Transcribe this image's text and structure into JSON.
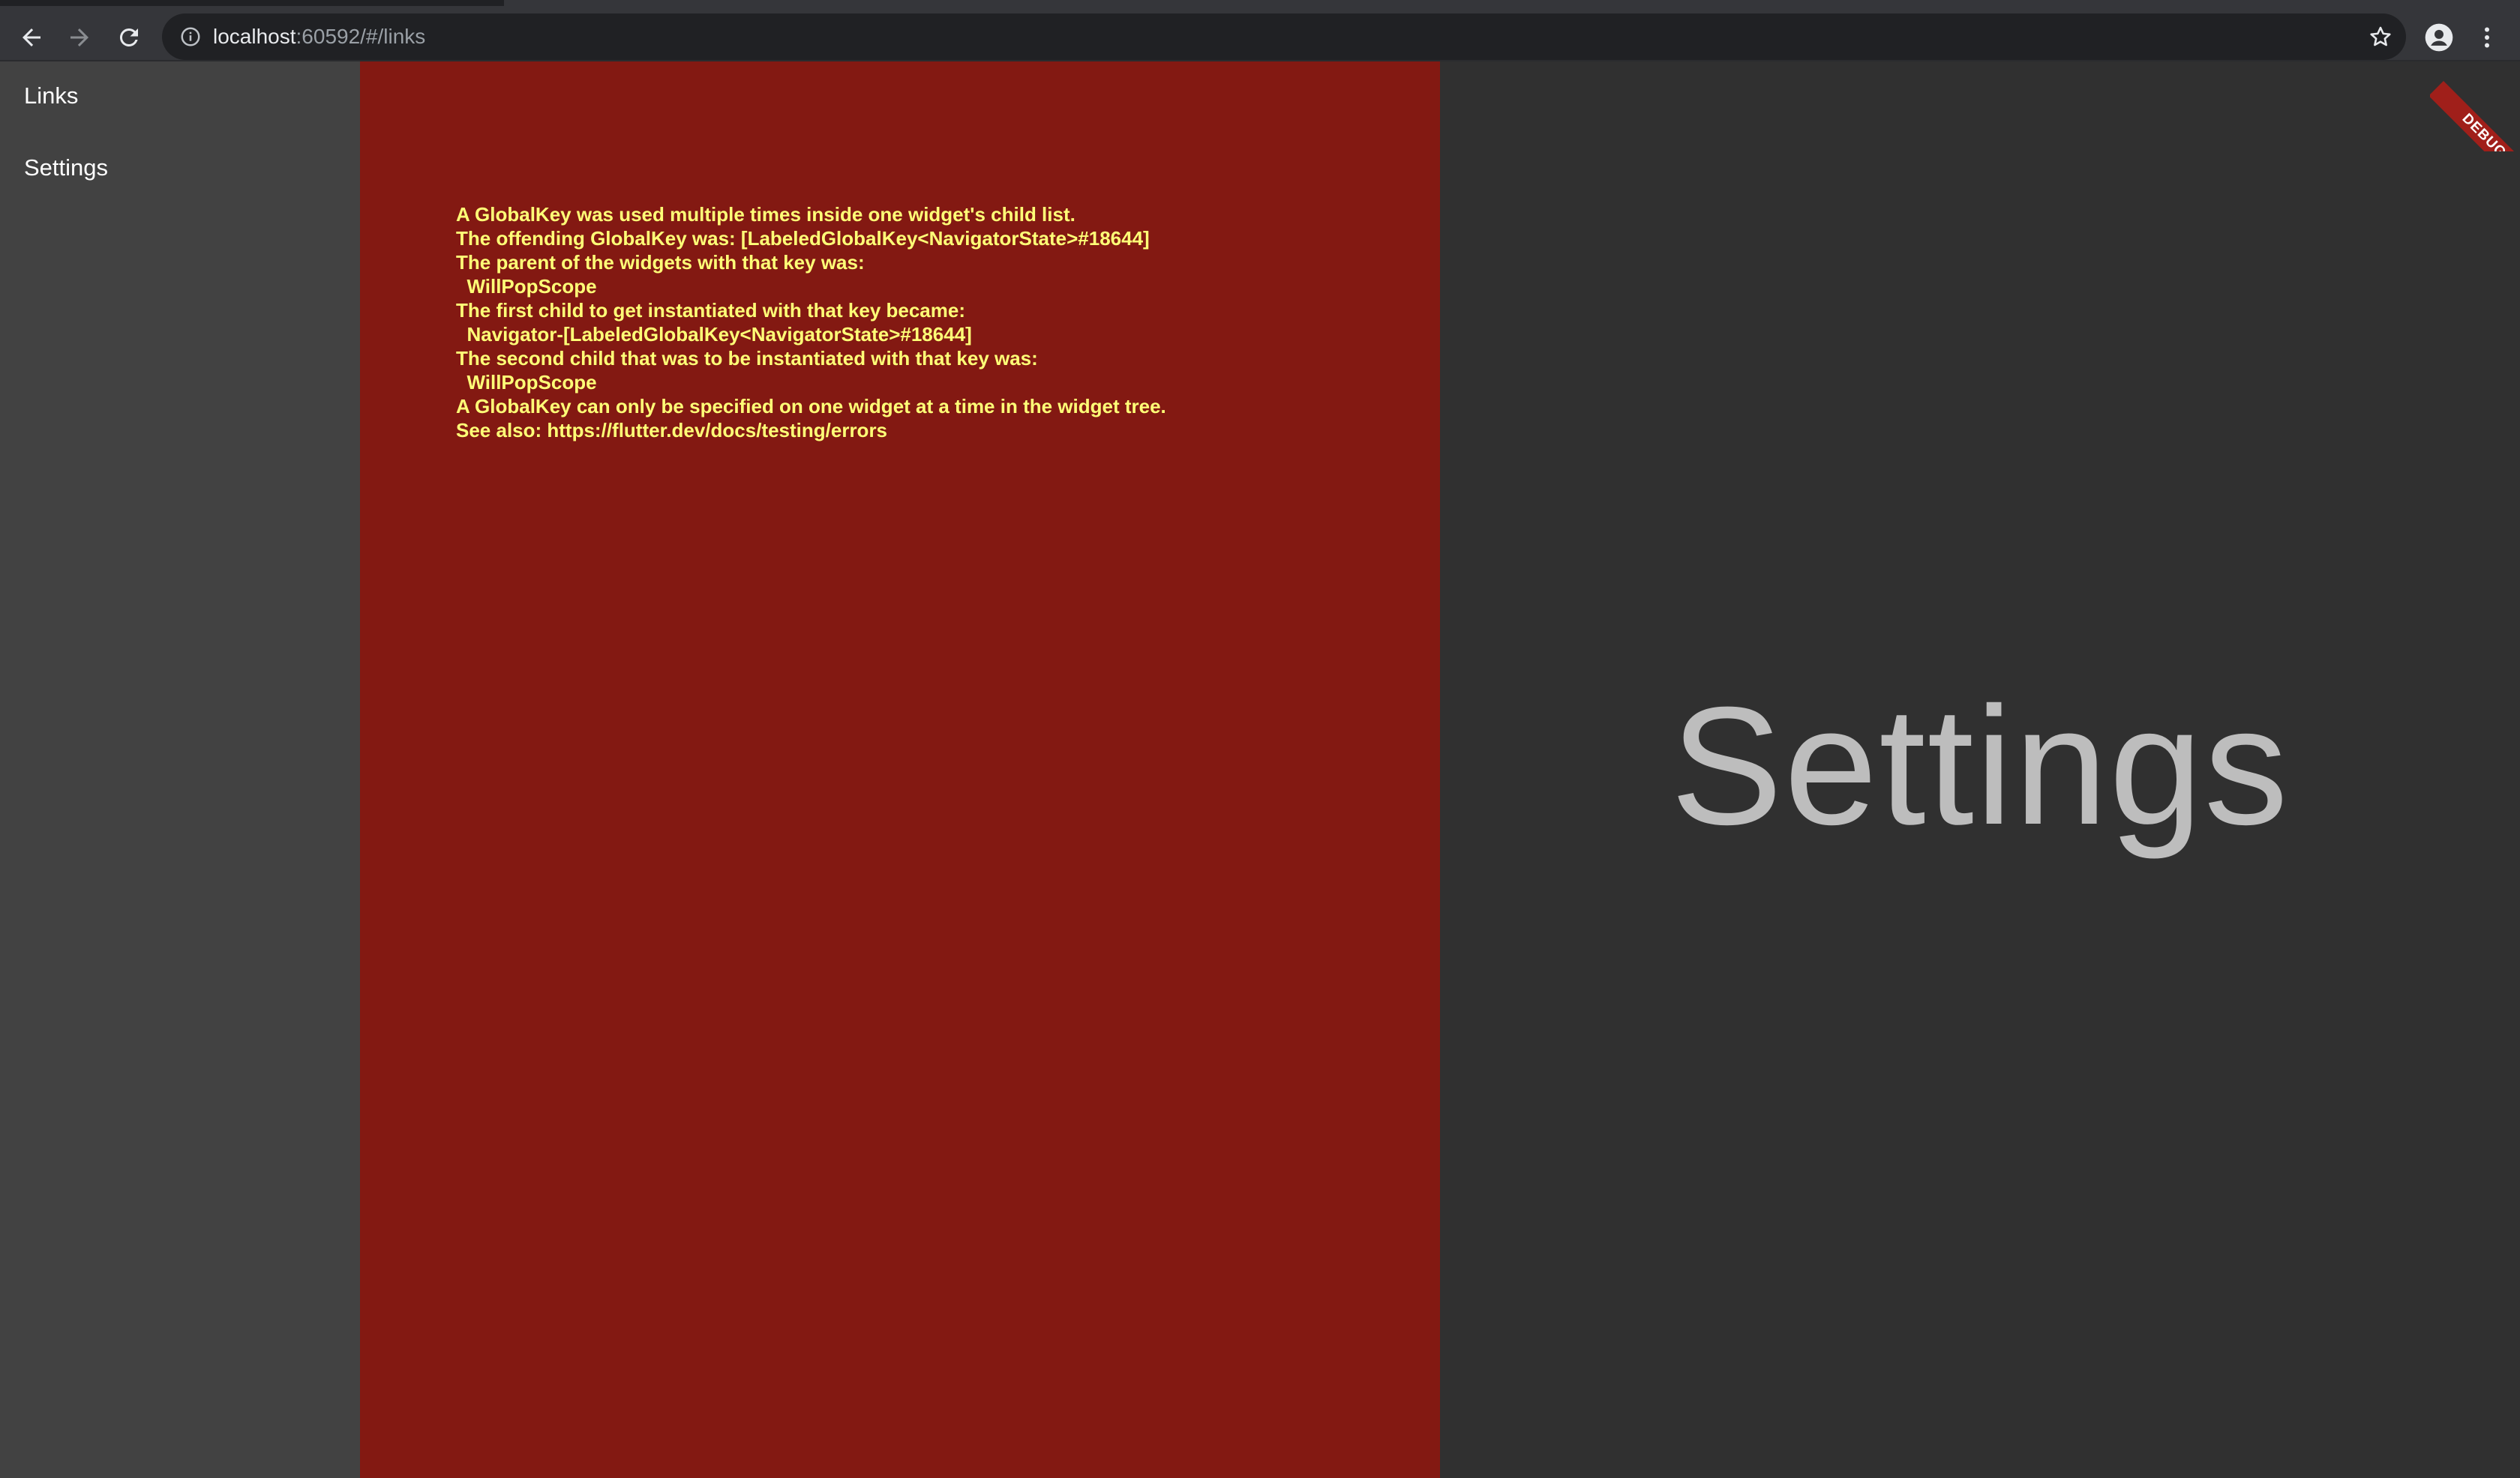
{
  "browser": {
    "url_host": "localhost",
    "url_rest": ":60592/#/links"
  },
  "drawer": {
    "items": [
      {
        "label": "Links"
      },
      {
        "label": "Settings"
      }
    ]
  },
  "error": {
    "lines": [
      "A GlobalKey was used multiple times inside one widget's child list.",
      "The offending GlobalKey was: [LabeledGlobalKey<NavigatorState>#18644]",
      "The parent of the widgets with that key was:",
      "  WillPopScope",
      "The first child to get instantiated with that key became:",
      "  Navigator-[LabeledGlobalKey<NavigatorState>#18644]",
      "The second child that was to be instantiated with that key was:",
      "  WillPopScope",
      "A GlobalKey can only be specified on one widget at a time in the widget tree.",
      "See also: https://flutter.dev/docs/testing/errors"
    ]
  },
  "settings": {
    "heading": "Settings"
  },
  "debug_banner": {
    "label": "DEBUG"
  },
  "colors": {
    "error_background": "#831912",
    "error_text": "#ffff77",
    "drawer_background": "#424242",
    "page_background": "#303030",
    "browser_toolbar": "#35363a"
  },
  "icons": {
    "back": "arrow-back-icon",
    "forward": "arrow-forward-icon",
    "reload": "reload-icon",
    "site_info": "info-icon",
    "bookmark": "star-icon",
    "profile": "profile-icon",
    "menu": "kebab-menu-icon"
  }
}
